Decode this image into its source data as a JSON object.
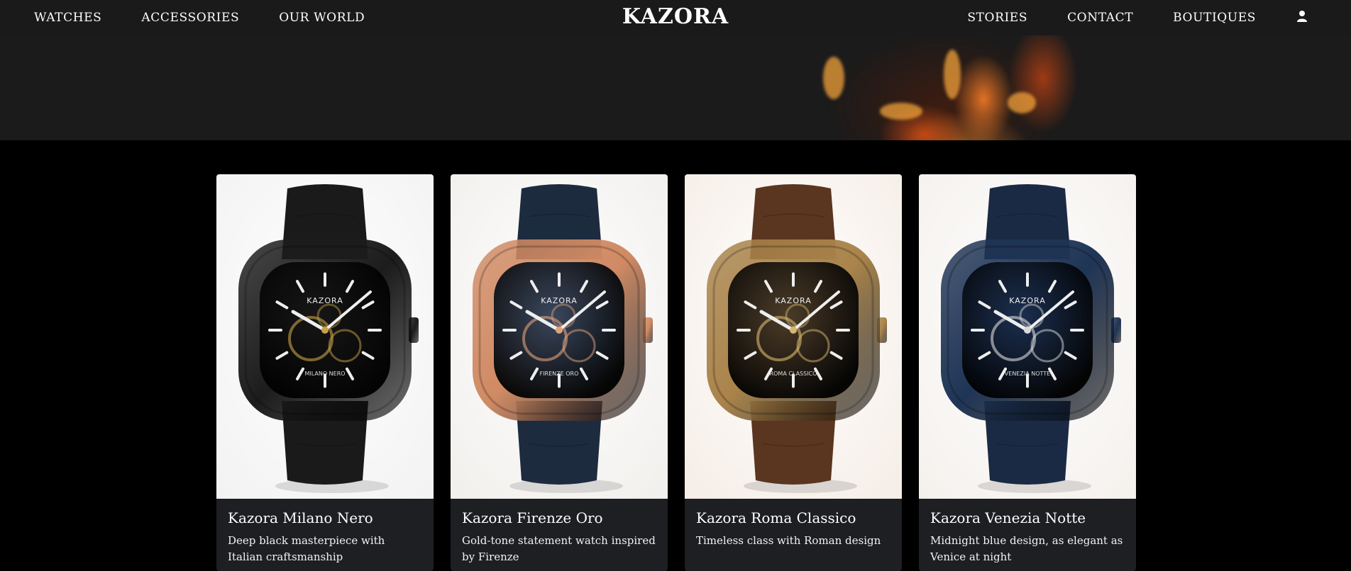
{
  "nav": {
    "left": [
      "WATCHES",
      "ACCESSORIES",
      "OUR WORLD"
    ],
    "logo": "KAZORA",
    "right": [
      "STORIES",
      "CONTACT",
      "BOUTIQUES"
    ],
    "user_icon": "user-icon"
  },
  "products": [
    {
      "name": "Kazora Milano Nero",
      "description": "Deep black masterpiece with Italian craftsmanship",
      "dial_brand": "KAZORA",
      "dial_label": "MILANO NERO",
      "background": "#f2f2f2",
      "case_color": "#1c1c1c",
      "dial_color": "#141414",
      "strap_color": "#1a1a1a",
      "accent_color": "#c9a14a"
    },
    {
      "name": "Kazora Firenze Oro",
      "description": "Gold-tone statement watch inspired by Firenze",
      "dial_brand": "KAZORA",
      "dial_label": "FIRENZE ORO",
      "background": "#f1efec",
      "case_color": "#d08a63",
      "dial_color": "#1f3a5a",
      "strap_color": "#1d2b3f",
      "accent_color": "#e0a27a"
    },
    {
      "name": "Kazora Roma Classico",
      "description": "Timeless class with Roman design",
      "dial_brand": "KAZORA",
      "dial_label": "ROMA CLASSICO",
      "background": "#f5ede6",
      "case_color": "#a9834a",
      "dial_color": "#3a2e22",
      "strap_color": "#5a3520",
      "accent_color": "#d8b870"
    },
    {
      "name": "Kazora Venezia Notte",
      "description": "Midnight blue design, as elegant as Venice at night",
      "dial_brand": "KAZORA",
      "dial_label": "VENEZIA NOTTE",
      "background": "#f4f0ec",
      "case_color": "#1f3556",
      "dial_color": "#1a2d4d",
      "strap_color": "#1b2a44",
      "accent_color": "#d9d9d9"
    }
  ]
}
